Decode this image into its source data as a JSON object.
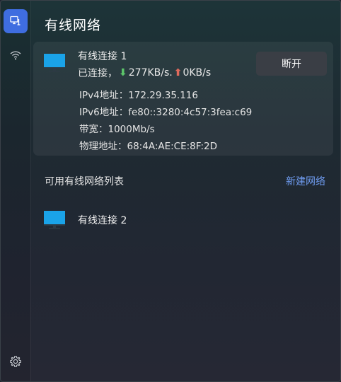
{
  "window": {
    "title": "有线网络"
  },
  "sidebar": {
    "items": [
      {
        "icon": "wired-network-icon",
        "active": true
      },
      {
        "icon": "wifi-icon",
        "active": false
      }
    ],
    "settings_icon": "gear-icon"
  },
  "connected": {
    "name": "有线连接 1",
    "status_prefix": "已连接，",
    "download_arrow": "⬇",
    "download": "277KB/s.",
    "upload_arrow": "⬆",
    "upload": "0KB/s",
    "disconnect_label": "断开",
    "details": [
      {
        "label": "IPv4地址：",
        "value": "172.29.35.116"
      },
      {
        "label": "IPv6地址：",
        "value": "fe80::3280:4c57:3fea:c69"
      },
      {
        "label": "带宽：",
        "value": "1000Mb/s"
      },
      {
        "label": "物理地址：",
        "value": "68:4A:AE:CE:8F:2D"
      }
    ]
  },
  "available": {
    "section_title": "可用有线网络列表",
    "new_network_label": "新建网络",
    "items": [
      {
        "name": "有线连接 2"
      }
    ]
  },
  "colors": {
    "accent": "#3f6de0",
    "link": "#6f9cf0",
    "download_arrow": "#5cc46a",
    "upload_arrow": "#e06a5c",
    "monitor": "#1aa3e8"
  }
}
